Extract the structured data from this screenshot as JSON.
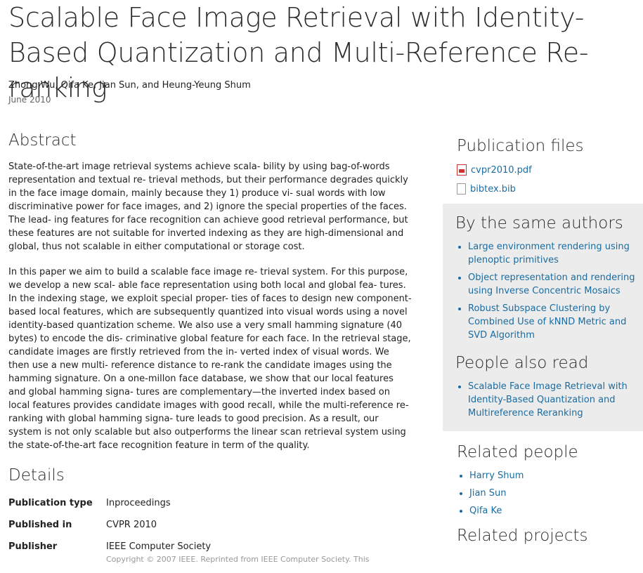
{
  "title": "Scalable Face Image Retrieval with Identity-Based Quantization and Multi-Reference Re-ranking",
  "authors": "Zhong Wu, Qifa Ke, Jian Sun, and Heung-Yeung Shum",
  "date": "June 2010",
  "abstract": {
    "heading": "Abstract",
    "p1": "State-of-the-art image retrieval systems achieve scala- bility by using bag-of-words representation and textual re- trieval methods, but their performance degrades quickly in the face image domain, mainly because they 1) produce vi- sual words with low discriminative power for face images, and 2) ignore the special properties of the faces. The lead- ing features for face recognition can achieve good retrieval performance, but these features are not suitable for inverted indexing as they are high-dimensional and global, thus not scalable in either computational or storage cost.",
    "p2": "In this paper we aim to build a scalable face image re- trieval system. For this purpose, we develop a new scal- able face representation using both local and global fea- tures. In the indexing stage, we exploit special proper- ties of faces to design new component-based local features, which are subsequently quantized into visual words using a novel identity-based quantization scheme. We also use a very small hamming signature (40 bytes) to encode the dis- criminative global feature for each face. In the retrieval stage, candidate images are firstly retrieved from the in- verted index of visual words. We then use a new multi- reference distance to re-rank the candidate images using the hamming signature. On a one-millon face database, we show that our local features and global hamming signa- tures are complementary—the inverted index based on local features provides candidate images with good recall, while the multi-reference re-ranking with global hamming signa- ture leads to good precision. As a result, our system is not only scalable but also outperforms the linear scan retrieval system using the state-of-the-art face recognition feature in term of the quality."
  },
  "details": {
    "heading": "Details",
    "rows": [
      {
        "key": "Publication type",
        "value": "Inproceedings"
      },
      {
        "key": "Published in",
        "value": "CVPR 2010"
      },
      {
        "key": "Publisher",
        "value": "IEEE Computer Society"
      }
    ],
    "copyright": "Copyright © 2007 IEEE. Reprinted from IEEE Computer Society. This"
  },
  "sidebar": {
    "files_heading": "Publication files",
    "files": [
      {
        "name": "cvpr2010.pdf",
        "icon": "pdf-file-icon"
      },
      {
        "name": "bibtex.bib",
        "icon": "document-icon"
      }
    ],
    "same_authors_heading": "By the same authors",
    "same_authors": [
      "Large environment rendering using plenoptic primitives",
      "Object representation and rendering using Inverse Concentric Mosaics",
      "Robust Subspace Clustering by Combined Use of kNND Metric and SVD Algorithm"
    ],
    "also_read_heading": "People also read",
    "also_read": [
      "Scalable Face Image Retrieval with Identity-Based Quantization and Multireference Reranking"
    ],
    "related_people_heading": "Related people",
    "related_people": [
      "Harry Shum",
      "Jian Sun",
      "Qifa Ke"
    ],
    "related_projects_heading": "Related projects"
  },
  "colors": {
    "link": "#1a6ca0",
    "sidebar_gray": "#ececec"
  }
}
